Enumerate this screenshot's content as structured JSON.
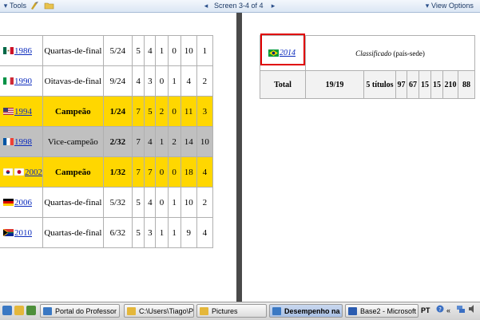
{
  "toolbar": {
    "tools_label": "Tools",
    "screen_label": "Screen 3-4 of 4",
    "view_options_label": "View Options"
  },
  "left_table": {
    "rows": [
      {
        "year": "1986",
        "stage": "Quartas-de-final",
        "pos": "5/24",
        "j": "5",
        "v": "4",
        "e": "1",
        "d": "0",
        "gp": "10",
        "gc": "1",
        "style": "normal",
        "flag": "mexico"
      },
      {
        "year": "1990",
        "stage": "Oitavas-de-final",
        "pos": "9/24",
        "j": "4",
        "v": "3",
        "e": "0",
        "d": "1",
        "gp": "4",
        "gc": "2",
        "style": "normal",
        "flag": "italy"
      },
      {
        "year": "1994",
        "stage": "Campeão",
        "pos": "1/24",
        "j": "7",
        "v": "5",
        "e": "2",
        "d": "0",
        "gp": "11",
        "gc": "3",
        "style": "gold",
        "flag": "usa"
      },
      {
        "year": "1998",
        "stage": "Vice-campeão",
        "pos": "2/32",
        "j": "7",
        "v": "4",
        "e": "1",
        "d": "2",
        "gp": "14",
        "gc": "10",
        "style": "silver",
        "flag": "france"
      },
      {
        "year": "2002",
        "stage": "Campeão",
        "pos": "1/32",
        "j": "7",
        "v": "7",
        "e": "0",
        "d": "0",
        "gp": "18",
        "gc": "4",
        "style": "gold",
        "flag": "korea-japan"
      },
      {
        "year": "2006",
        "stage": "Quartas-de-final",
        "pos": "5/32",
        "j": "5",
        "v": "4",
        "e": "0",
        "d": "1",
        "gp": "10",
        "gc": "2",
        "style": "normal",
        "flag": "germany"
      },
      {
        "year": "2010",
        "stage": "Quartas-de-final",
        "pos": "6/32",
        "j": "5",
        "v": "3",
        "e": "1",
        "d": "1",
        "gp": "9",
        "gc": "4",
        "style": "normal",
        "flag": "south-africa"
      }
    ]
  },
  "right_table": {
    "year_2014": "2014",
    "classified_italic": "Classificado",
    "classified_rest": "(país-sede)",
    "total": {
      "label": "Total",
      "participations": "19/19",
      "titles": "5 títulos",
      "j": "97",
      "v": "67",
      "e": "15",
      "d": "15",
      "gp": "210",
      "gc": "88"
    }
  },
  "taskbar": {
    "tasks": [
      {
        "label": "Portal do Professor ...",
        "icon": "ie-icon",
        "active": false
      },
      {
        "label": "C:\\Users\\Tiago\\Pict...",
        "icon": "folder-icon",
        "active": false
      },
      {
        "label": "Pictures",
        "icon": "folder-icon",
        "active": false
      },
      {
        "label": "Desempenho na ...",
        "icon": "ie-icon",
        "active": true
      },
      {
        "label": "Base2 - Microsoft W...",
        "icon": "word-icon",
        "active": false
      }
    ],
    "language": "PT"
  },
  "colors": {
    "gold": "#ffd700",
    "silver": "#c0c0c0",
    "link": "#0b2bbd",
    "highlight": "#e00000"
  }
}
